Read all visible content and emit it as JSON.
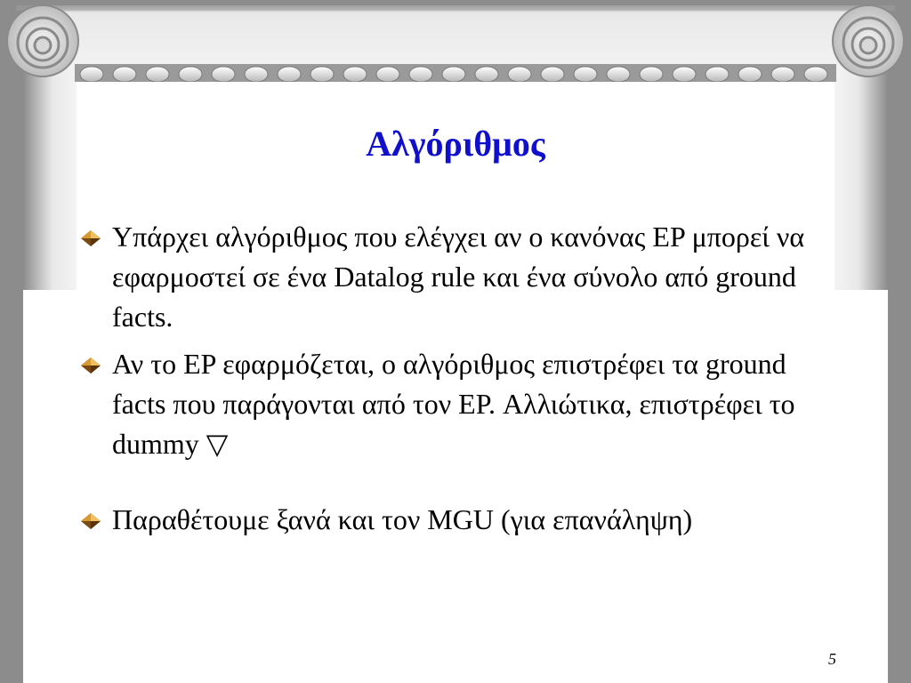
{
  "slide": {
    "title": "Αλγόριθμος",
    "bullets": [
      {
        "text": "Υπάρχει αλγόριθμος που ελέγχει αν ο κανόνας EP μπορεί να εφαρμοστεί σε ένα Datalog rule και ένα σύνολο από ground facts."
      },
      {
        "text": "Αν το EP εφαρμόζεται, ο αλγόριθμος επιστρέφει τα ground facts που παράγονται από τον EP. Αλλιώτικα, επιστρέφει το dummy ▽"
      },
      {
        "text": "Παραθέτουμε ξανά και τον MGU (για επανάληψη)"
      }
    ],
    "page_number": "5",
    "bullet_icon": "diamond-bullet-icon"
  },
  "colors": {
    "title": "#1010cc",
    "text": "#000000",
    "frame_dark": "#8c8c8c",
    "frame_light": "#e6e6e6",
    "bullet_light": "#f0c060",
    "bullet_dark": "#7a4a10"
  }
}
